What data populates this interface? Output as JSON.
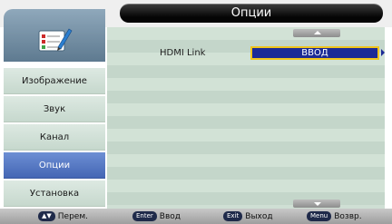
{
  "header": {
    "title": "Опции"
  },
  "sidebar": {
    "logo_icon": "settings-checklist-icon",
    "items": [
      {
        "label": "Изображение",
        "active": false
      },
      {
        "label": "Звук",
        "active": false
      },
      {
        "label": "Канал",
        "active": false
      },
      {
        "label": "Опции",
        "active": true
      },
      {
        "label": "Установка",
        "active": false
      }
    ]
  },
  "panel": {
    "setting": {
      "label": "HDMI Link",
      "value": "ВВОД"
    }
  },
  "footer": {
    "hints": [
      {
        "key": "▲▼",
        "label": "Перем."
      },
      {
        "key": "Enter",
        "label": "Ввод"
      },
      {
        "key": "Exit",
        "label": "Выход"
      },
      {
        "key": "Menu",
        "label": "Возвр."
      }
    ]
  },
  "colors": {
    "active_item": "#4466b4",
    "highlight_border": "#f0c41c",
    "value_box": "#1c2a96",
    "panel_bg": "#cfdfd4"
  }
}
